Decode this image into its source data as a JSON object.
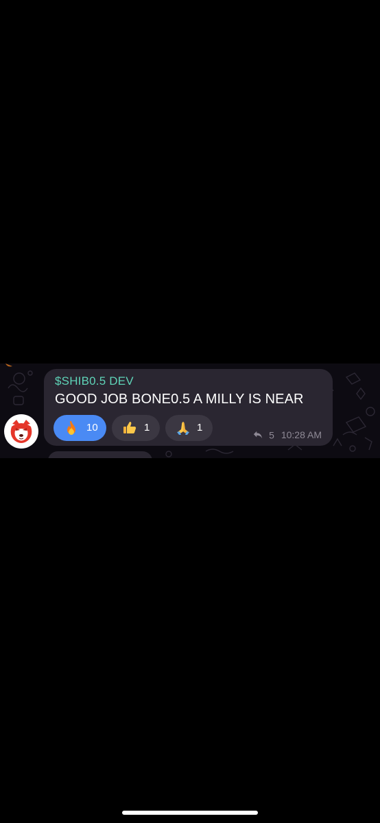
{
  "message": {
    "sender": "$SHIB0.5 DEV",
    "text": "GOOD JOB BONE0.5 A MILLY IS NEAR",
    "reply_count": "5",
    "time": "10:28 AM"
  },
  "reactions": [
    {
      "emoji_name": "fire-emoji",
      "count": "10",
      "active": true
    },
    {
      "emoji_name": "thumbs-up-emoji",
      "count": "1",
      "active": false
    },
    {
      "emoji_name": "folded-hands-emoji",
      "count": "1",
      "active": false
    }
  ],
  "colors": {
    "background": "#000000",
    "chat_background": "#0d0b12",
    "bubble": "#2a2631",
    "sender_name": "#5fd4b8",
    "reaction_active": "#4a8af4",
    "reaction_inactive": "#3b3742",
    "meta_text": "#8f8a96"
  },
  "icons": {
    "avatar": "shiba-inu-avatar",
    "reply": "reply-arrow-icon"
  }
}
